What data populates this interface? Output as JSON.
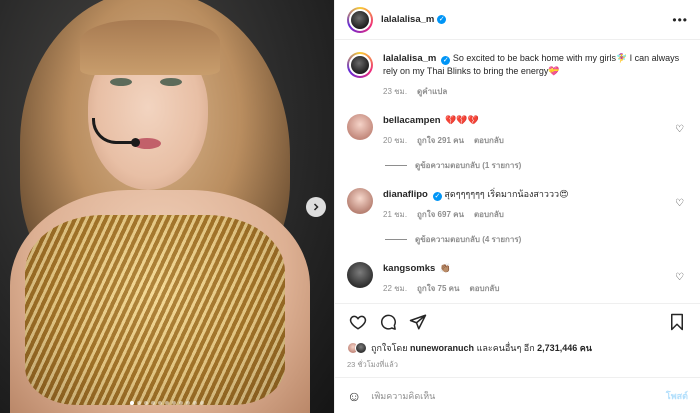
{
  "post": {
    "username": "lalalalisa_m",
    "image_page_indicator": {
      "total": 11,
      "active": 0
    }
  },
  "caption": {
    "username": "lalalalisa_m",
    "text": "So excited to be back home with my girls🧚‍♀️ I can always rely on my Thai Blinks to bring the energy💝",
    "time": "23 ชม.",
    "translate": "ดูคำแปล"
  },
  "comments": [
    {
      "username": "bellacampen",
      "text": "💔💔💔",
      "time": "20 ชม.",
      "likes": "ถูกใจ 291 คน",
      "reply": "",
      "view_replies": "ดูข้อความตอบกลับ (1 รายการ)"
    },
    {
      "username": "dianaflipo",
      "text": "สุดๆๆๆๆๆๆ เริ่ดมากน้องสาววว😍",
      "time": "21 ชม.",
      "likes": "ถูกใจ 697 คน",
      "reply": "ตอบกลับ",
      "view_replies": "ดูข้อความตอบกลับ (4 รายการ)"
    },
    {
      "username": "kangsomks",
      "text": "👏🏽",
      "time": "22 ชม.",
      "likes": "ถูกใจ 75 คน",
      "reply": "ตอบกลับ"
    }
  ],
  "bella_reply_label": "ตอบกลับ",
  "likes_summary": {
    "prefix": "ถูกใจโดย",
    "user": "nuneworanuch",
    "middle": "และคนอื่นๆ อีก",
    "count": "2,731,446 คน"
  },
  "posted_time": "23 ชั่วโมงที่แล้ว",
  "composer": {
    "placeholder": "เพิ่มความคิดเห็น",
    "post_label": "โพสต์"
  },
  "colors": {
    "accent": "#0095f6",
    "post_disabled": "#b2dffc",
    "muted": "#8e8e8e"
  }
}
